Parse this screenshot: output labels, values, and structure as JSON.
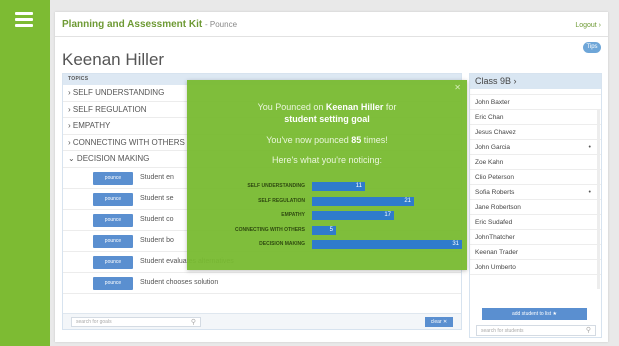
{
  "app": {
    "title": "Planning and Assessment Kit",
    "subtitle": "- Pounce",
    "logout": "Logout ›",
    "help": "Tips"
  },
  "student": {
    "name": "Keenan Hiller"
  },
  "topics": {
    "header": "TOPICS",
    "items": [
      "› SELF UNDERSTANDING",
      "› SELF REGULATION",
      "› EMPATHY",
      "› CONNECTING WITH OTHERS",
      "⌄ DECISION MAKING"
    ],
    "pounce_label": "pounce",
    "goals": [
      "Student en",
      "Student se",
      "Student co",
      "Student bo",
      "Student evaluates alternatives",
      "Student chooses solution"
    ],
    "search_placeholder": "search for goals",
    "clear_label": "clear ✕"
  },
  "class": {
    "header": "Class 9B ›",
    "students": [
      {
        "name": "John Baxter",
        "dot": false
      },
      {
        "name": "Eric Chan",
        "dot": false
      },
      {
        "name": "Jesus Chavez",
        "dot": false
      },
      {
        "name": "John Garcia",
        "dot": true
      },
      {
        "name": "Zoe Kahn",
        "dot": false
      },
      {
        "name": "Clio Peterson",
        "dot": false
      },
      {
        "name": "Sofia Roberts",
        "dot": true
      },
      {
        "name": "Jane Robertson",
        "dot": false
      },
      {
        "name": "Eric Sudafed",
        "dot": false
      },
      {
        "name": "JohnThatcher",
        "dot": false
      },
      {
        "name": "Keenan Trader",
        "dot": false
      },
      {
        "name": "John Umberto",
        "dot": false
      }
    ],
    "add_label": "add student to list ★",
    "search_placeholder": "search for students"
  },
  "popup": {
    "line1_pre": "You Pounced on ",
    "line1_name": "Keenan Hiller",
    "line1_post": " for",
    "line1_goal": "student setting goal",
    "line2_pre": "You've now pounced ",
    "line2_count": "85",
    "line2_post": " times!",
    "line3": "Here's what you're noticing:",
    "close": "✕"
  },
  "chart_data": {
    "type": "bar",
    "orientation": "horizontal",
    "categories": [
      "SELF UNDERSTANDING",
      "SELF REGULATION",
      "EMPATHY",
      "CONNECTING WITH OTHERS",
      "DECISION MAKING"
    ],
    "values": [
      11,
      21,
      17,
      5,
      31
    ],
    "xlim": [
      0,
      31
    ],
    "bar_color": "#2f7bcc"
  },
  "colors": {
    "brand_green": "#7dbb33",
    "accent_blue": "#5a8fd0"
  }
}
